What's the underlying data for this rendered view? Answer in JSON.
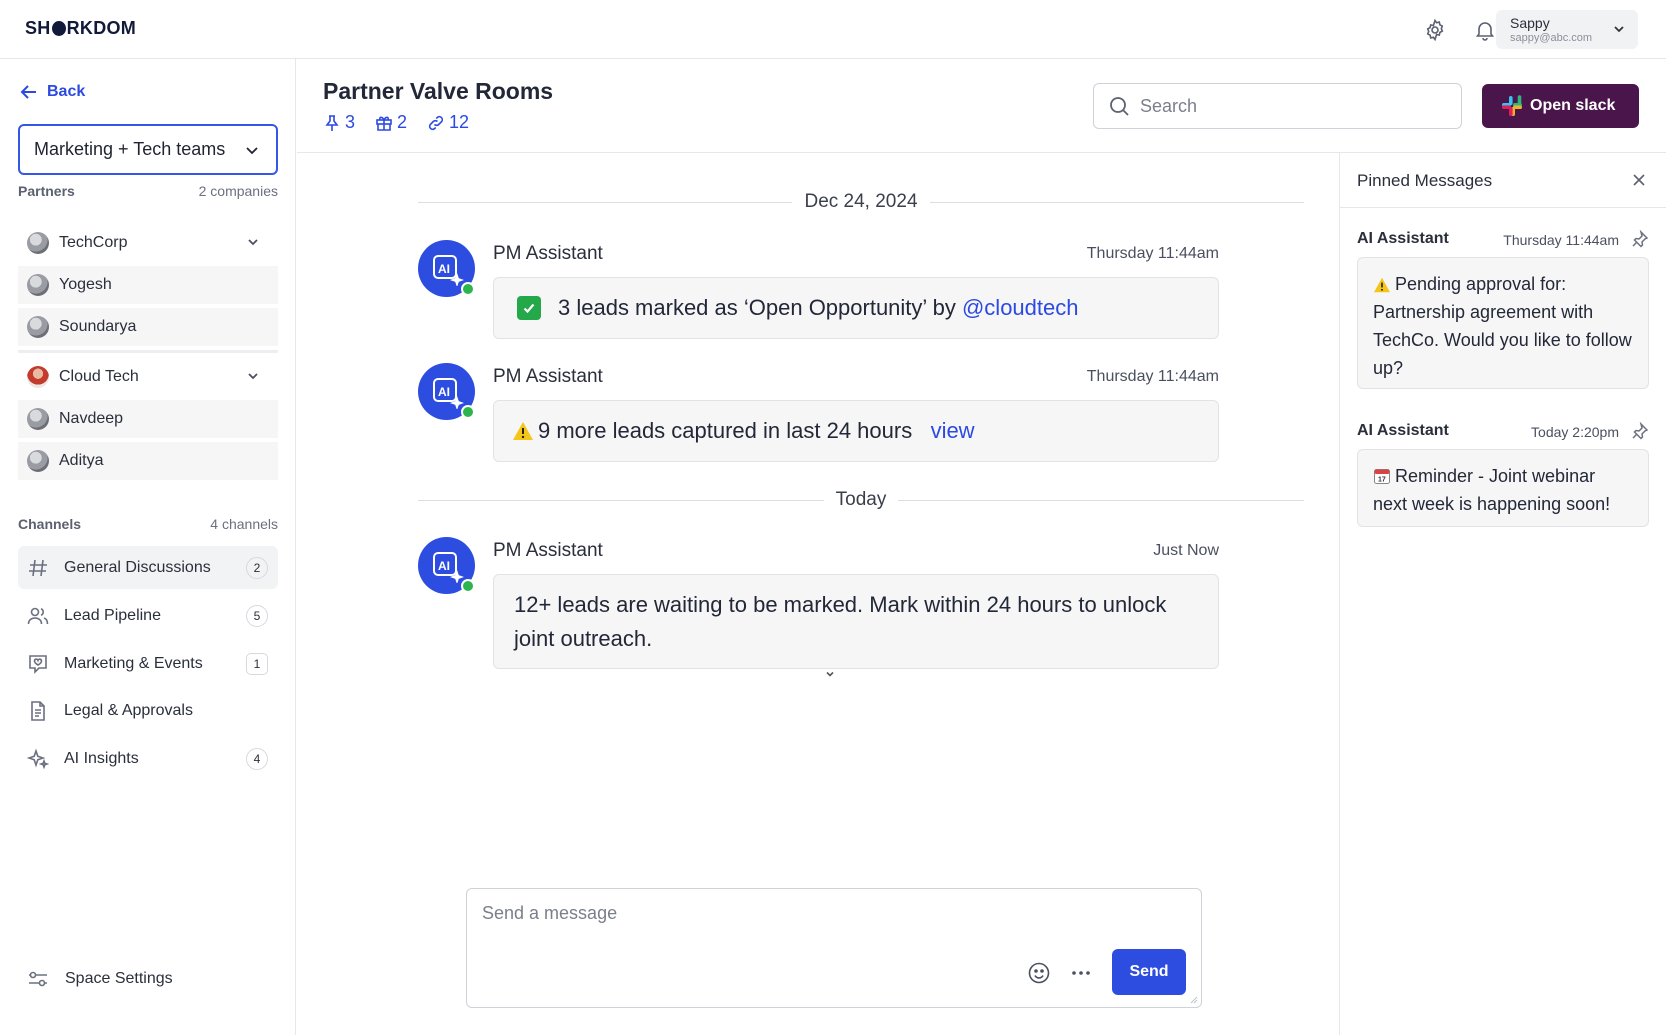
{
  "app": {
    "logo_text": "SHARKDOM"
  },
  "topbar": {
    "settings_icon": "gear-icon",
    "notifications_icon": "bell-icon",
    "user": {
      "name": "Sappy",
      "email": "sappy@abc.com"
    }
  },
  "sidebar": {
    "back_label": "Back",
    "team_selector": "Marketing + Tech teams",
    "partners": {
      "title": "Partners",
      "count": "2 companies",
      "companies": [
        {
          "name": "TechCorp",
          "members": [
            "Yogesh",
            "Soundarya"
          ]
        },
        {
          "name": "Cloud Tech",
          "members": [
            "Navdeep",
            "Aditya"
          ]
        }
      ]
    },
    "channels": {
      "title": "Channels",
      "count": "4 channels",
      "items": [
        {
          "label": "General Discussions",
          "badge": "2",
          "icon": "hash-icon"
        },
        {
          "label": "Lead Pipeline",
          "badge": "5",
          "icon": "users-icon"
        },
        {
          "label": "Marketing & Events",
          "badge": "1",
          "icon": "chat-heart-icon"
        },
        {
          "label": "Legal & Approvals",
          "badge": "",
          "icon": "document-icon"
        },
        {
          "label": "AI Insights",
          "badge": "4",
          "icon": "sparkles-icon"
        }
      ]
    },
    "space_settings": "Space Settings"
  },
  "room": {
    "title": "Partner Valve Rooms",
    "pins": "3",
    "gifts": "2",
    "links": "12",
    "search_placeholder": "Search",
    "open_slack": "Open slack"
  },
  "chat": {
    "date_sep_1": "Dec 24, 2024",
    "date_sep_2": "Today",
    "messages": [
      {
        "sender": "PM Assistant",
        "time": "Thursday 11:44am",
        "text": "3 leads marked as ‘Open Opportunity’ by",
        "mention": "@cloudtech"
      },
      {
        "sender": "PM Assistant",
        "time": "Thursday 11:44am",
        "text": "9 more leads captured in last 24 hours",
        "link": "view"
      },
      {
        "sender": "PM Assistant",
        "time": "Just Now",
        "text": "12+ leads are waiting to be marked. Mark within 24 hours to unlock joint outreach."
      }
    ]
  },
  "composer": {
    "placeholder": "Send a message",
    "send_label": "Send"
  },
  "pinned": {
    "title": "Pinned Messages",
    "items": [
      {
        "author": "AI Assistant",
        "time": "Thursday 11:44am",
        "text": "Pending approval for: Partnership agreement with TechCo. Would you like to follow up?"
      },
      {
        "author": "AI Assistant",
        "time": "Today 2:20pm",
        "text": "Reminder - Joint webinar next week is happening soon!"
      }
    ]
  },
  "colors": {
    "accent": "#2d4de0",
    "slack": "#4a154b",
    "online": "#2bb54c",
    "check": "#24a84a"
  }
}
